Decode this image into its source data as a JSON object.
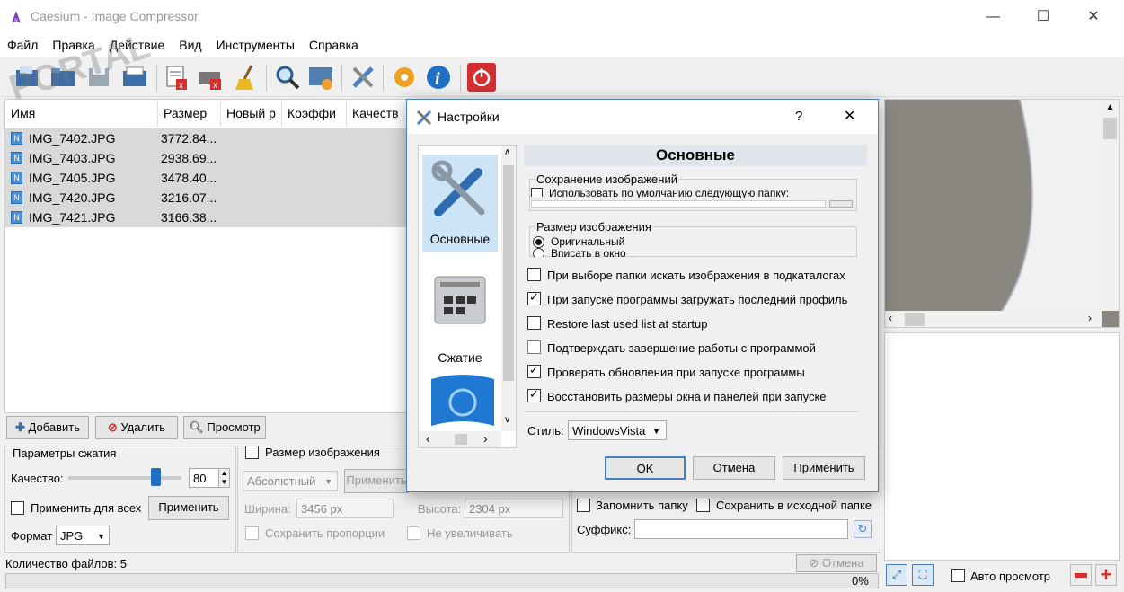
{
  "app": {
    "title": "Caesium - Image Compressor"
  },
  "menu": [
    "Файл",
    "Правка",
    "Действие",
    "Вид",
    "Инструменты",
    "Справка"
  ],
  "watermark": "PORTAL",
  "grid": {
    "columns": [
      "Имя",
      "Размер",
      "Новый р",
      "Коэффи",
      "Качеств"
    ],
    "rows": [
      {
        "name": "IMG_7402.JPG",
        "size": "3772.84..."
      },
      {
        "name": "IMG_7403.JPG",
        "size": "2938.69..."
      },
      {
        "name": "IMG_7405.JPG",
        "size": "3478.40..."
      },
      {
        "name": "IMG_7420.JPG",
        "size": "3216.07..."
      },
      {
        "name": "IMG_7421.JPG",
        "size": "3166.38..."
      }
    ]
  },
  "actions": {
    "add": "Добавить",
    "remove": "Удалить",
    "preview": "Просмотр"
  },
  "compression": {
    "group_title": "Параметры сжатия",
    "quality_label": "Качество:",
    "quality_value": "80",
    "quality_fraction": 0.8,
    "apply_all": "Применить для всех",
    "apply": "Применить",
    "format_label": "Формат",
    "format_value": "JPG"
  },
  "resize": {
    "title": "Размер изображения",
    "mode": "Абсолютный",
    "apply": "Применить",
    "width_label": "Ширина:",
    "width_value": "3456 px",
    "height_label": "Высота:",
    "height_value": "2304 px",
    "keep_ratio": "Сохранить пропорции",
    "no_enlarge": "Не увеличивать"
  },
  "output": {
    "remember_folder": "Запомнить папку",
    "save_source": "Сохранить в исходной папке",
    "suffix_label": "Суффикс:",
    "suffix_value": ""
  },
  "status": {
    "file_count": "Количество файлов: 5",
    "cancel": "Отмена",
    "progress": "0%"
  },
  "bottom_bar": {
    "auto_preview": "Авто просмотр"
  },
  "dialog": {
    "title": "Настройки",
    "help": "?",
    "categories": [
      "Основные",
      "Сжатие"
    ],
    "heading": "Основные",
    "save_group": "Сохранение изображений",
    "use_default_folder": "Использовать по умолчанию следующую папку:",
    "size_group": "Размер изображения",
    "size_original": "Оригинальный",
    "size_fit": "Вписать в окно",
    "options": [
      {
        "label": "При выборе папки искать изображения в подкаталогах",
        "checked": false
      },
      {
        "label": "При запуске программы загружать последний профиль",
        "checked": true
      },
      {
        "label": "Restore last used list at startup",
        "checked": false
      },
      {
        "label": "Подтверждать завершение работы с программой",
        "checked": false
      },
      {
        "label": "Проверять обновления при запуске программы",
        "checked": true
      },
      {
        "label": "Восстановить размеры окна и панелей при запуске",
        "checked": true
      }
    ],
    "style_label": "Стиль:",
    "style_value": "WindowsVista",
    "ok": "OK",
    "cancel": "Отмена",
    "apply": "Применить"
  },
  "colors": {
    "accent": "#4a7fc1",
    "danger": "#d32f2f",
    "selection": "#d9d9d9"
  }
}
